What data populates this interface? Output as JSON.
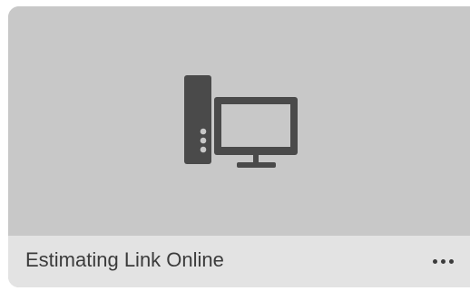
{
  "tile": {
    "title": "Estimating Link Online",
    "icon": "desktop-computer-icon",
    "menu_icon": "more-horizontal-icon"
  },
  "colors": {
    "thumbnail_bg": "#c8c8c8",
    "footer_bg": "#e3e3e3",
    "icon": "#4a4a4a",
    "text": "#3b3b3b"
  }
}
